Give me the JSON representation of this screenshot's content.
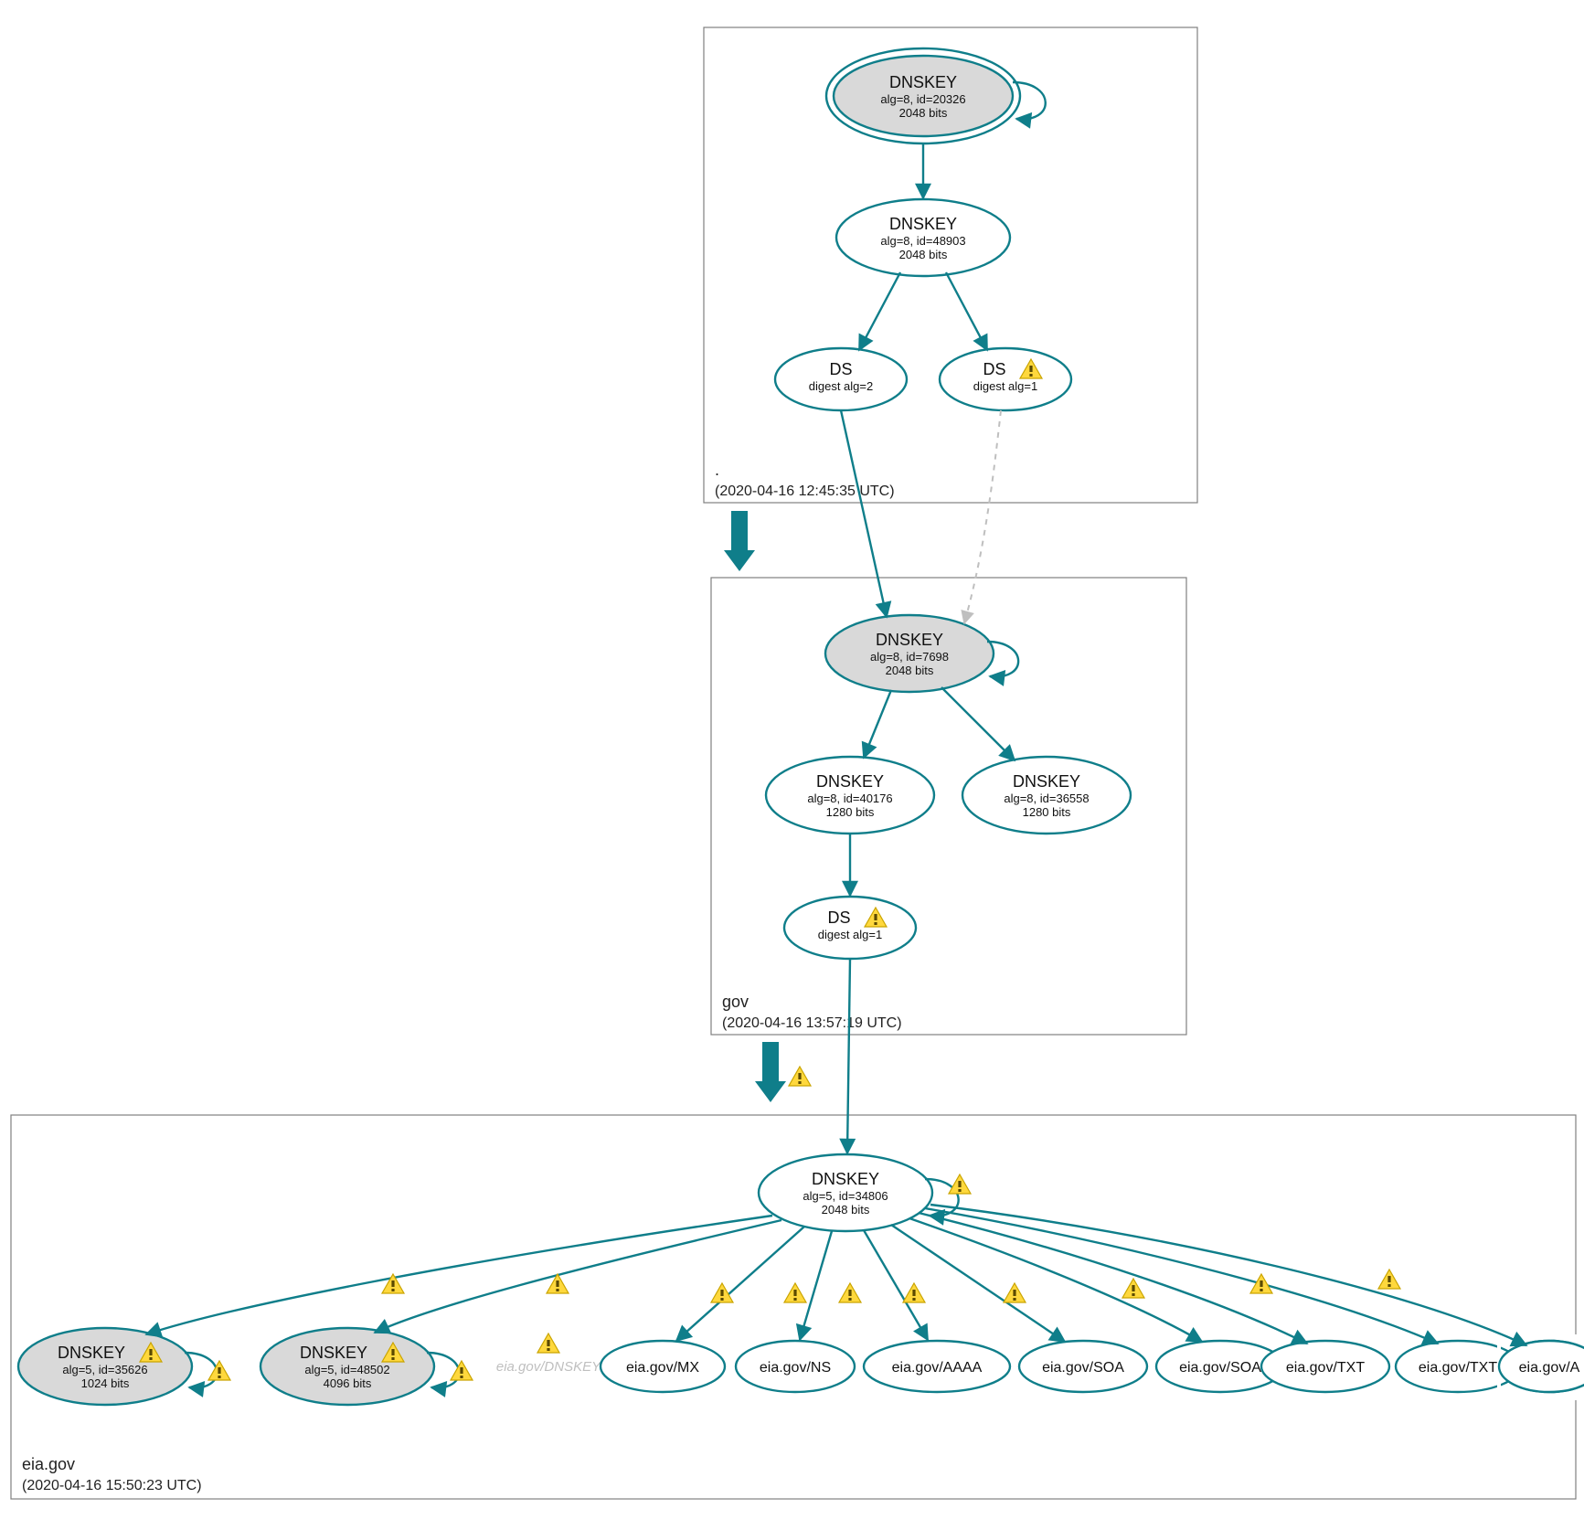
{
  "colors": {
    "stroke": "#0f7e8a",
    "grey_fill": "#d9d9d9",
    "box": "#808080",
    "faded": "#bfbfbf"
  },
  "zones": {
    "root": {
      "name": ".",
      "timestamp": "(2020-04-16 12:45:35 UTC)"
    },
    "gov": {
      "name": "gov",
      "timestamp": "(2020-04-16 13:57:19 UTC)"
    },
    "eia": {
      "name": "eia.gov",
      "timestamp": "(2020-04-16 15:50:23 UTC)"
    }
  },
  "nodes": {
    "root_ksk": {
      "title": "DNSKEY",
      "l1": "alg=8, id=20326",
      "l2": "2048 bits"
    },
    "root_zsk": {
      "title": "DNSKEY",
      "l1": "alg=8, id=48903",
      "l2": "2048 bits"
    },
    "root_ds2": {
      "title": "DS",
      "l1": "digest alg=2"
    },
    "root_ds1": {
      "title": "DS",
      "l1": "digest alg=1"
    },
    "gov_ksk": {
      "title": "DNSKEY",
      "l1": "alg=8, id=7698",
      "l2": "2048 bits"
    },
    "gov_zsk": {
      "title": "DNSKEY",
      "l1": "alg=8, id=40176",
      "l2": "1280 bits"
    },
    "gov_zsk2": {
      "title": "DNSKEY",
      "l1": "alg=8, id=36558",
      "l2": "1280 bits"
    },
    "gov_ds1": {
      "title": "DS",
      "l1": "digest alg=1"
    },
    "eia_ksk": {
      "title": "DNSKEY",
      "l1": "alg=5, id=34806",
      "l2": "2048 bits"
    },
    "eia_k1": {
      "title": "DNSKEY",
      "l1": "alg=5, id=35626",
      "l2": "1024 bits"
    },
    "eia_k2": {
      "title": "DNSKEY",
      "l1": "alg=5, id=48502",
      "l2": "4096 bits"
    },
    "eia_faded": {
      "label": "eia.gov/DNSKEY"
    },
    "rr1": {
      "label": "eia.gov/MX"
    },
    "rr2": {
      "label": "eia.gov/NS"
    },
    "rr3": {
      "label": "eia.gov/AAAA"
    },
    "rr4": {
      "label": "eia.gov/SOA"
    },
    "rr5": {
      "label": "eia.gov/SOA"
    },
    "rr6": {
      "label": "eia.gov/TXT"
    },
    "rr7": {
      "label": "eia.gov/TXT"
    },
    "rr8": {
      "label": "eia.gov/A"
    }
  }
}
